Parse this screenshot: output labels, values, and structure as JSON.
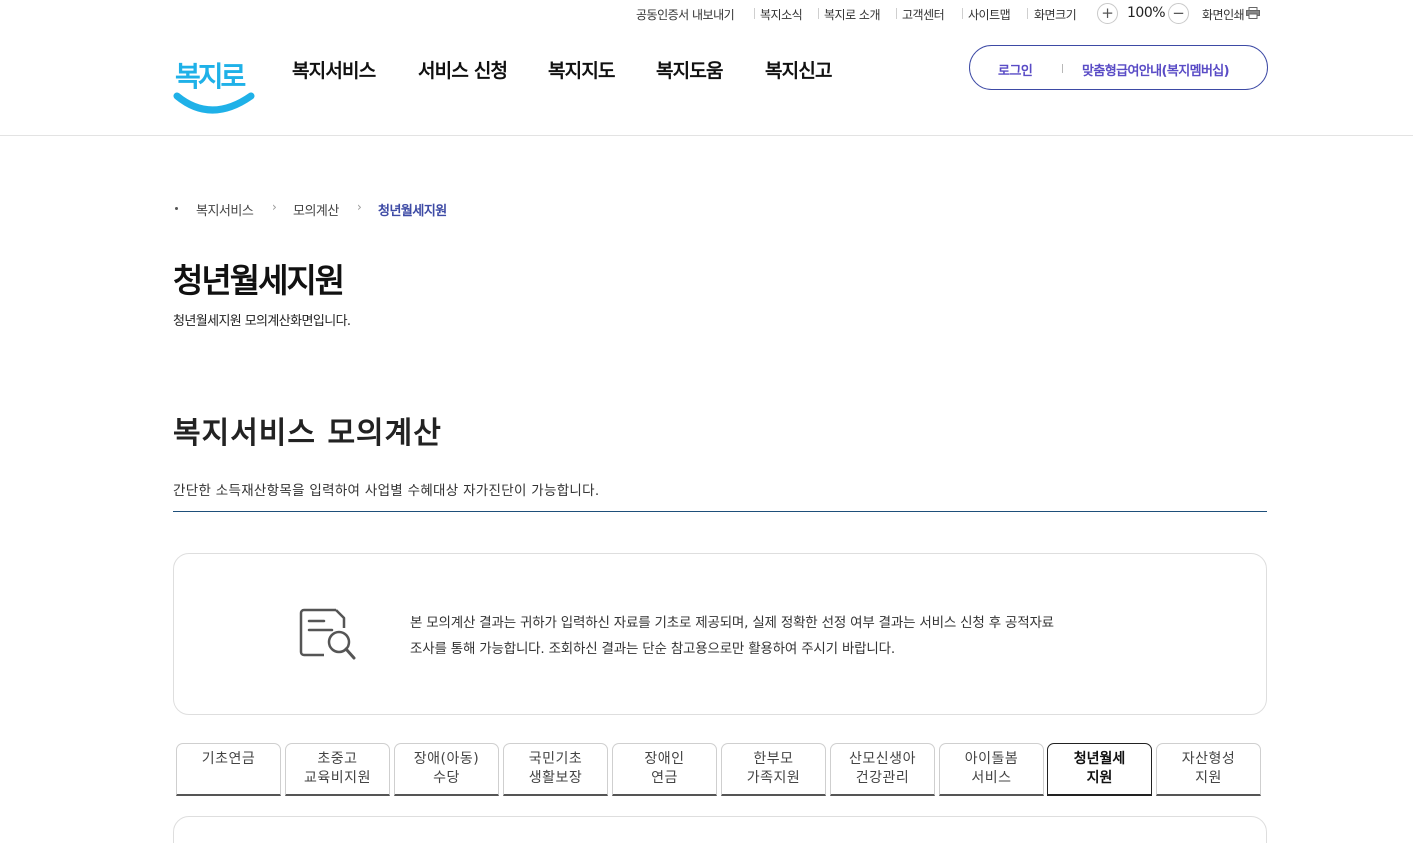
{
  "util": {
    "links": [
      "공동인증서 내보내기",
      "복지소식",
      "복지로 소개",
      "고객센터",
      "사이트맵"
    ],
    "font_size_label": "화면크기",
    "zoom_in": "+",
    "zoom_value": "100%",
    "zoom_out": "−",
    "print_label": "화면인쇄"
  },
  "header": {
    "logo_text": "복지로",
    "nav": [
      "복지서비스",
      "서비스 신청",
      "복지지도",
      "복지도움",
      "복지신고"
    ],
    "login": "로그인",
    "membership": "맞춤형급여안내(복지멤버십)"
  },
  "breadcrumb": {
    "items": [
      "복지서비스",
      "모의계산",
      "청년월세지원"
    ]
  },
  "page": {
    "title": "청년월세지원",
    "description": "청년월세지원 모의계산화면입니다."
  },
  "section": {
    "title": "복지서비스 모의계산",
    "description": "간단한 소득재산항목을 입력하여 사업별 수혜대상 자가진단이 가능합니다."
  },
  "notice": {
    "line1": "본 모의계산 결과는 귀하가 입력하신 자료를 기초로 제공되며, 실제 정확한 선정 여부 결과는 서비스 신청 후 공적자료",
    "line2": "조사를 통해 가능합니다. 조회하신 결과는 단순 참고용으로만 활용하여 주시기 바랍니다."
  },
  "tabs": [
    {
      "line1": "기초연금",
      "line2": ""
    },
    {
      "line1": "초중고",
      "line2": "교육비지원"
    },
    {
      "line1": "장애(아동)",
      "line2": "수당"
    },
    {
      "line1": "국민기초",
      "line2": "생활보장"
    },
    {
      "line1": "장애인",
      "line2": "연금"
    },
    {
      "line1": "한부모",
      "line2": "가족지원"
    },
    {
      "line1": "산모신생아",
      "line2": "건강관리"
    },
    {
      "line1": "아이돌봄",
      "line2": "서비스"
    },
    {
      "line1": "청년월세",
      "line2": "지원"
    },
    {
      "line1": "자산형성",
      "line2": "지원"
    }
  ],
  "active_tab": "청년월세지원",
  "colors": {
    "accent": "#3d4aa5",
    "logo_blue": "#1fb1e8",
    "section_line": "#1e4f7a"
  }
}
